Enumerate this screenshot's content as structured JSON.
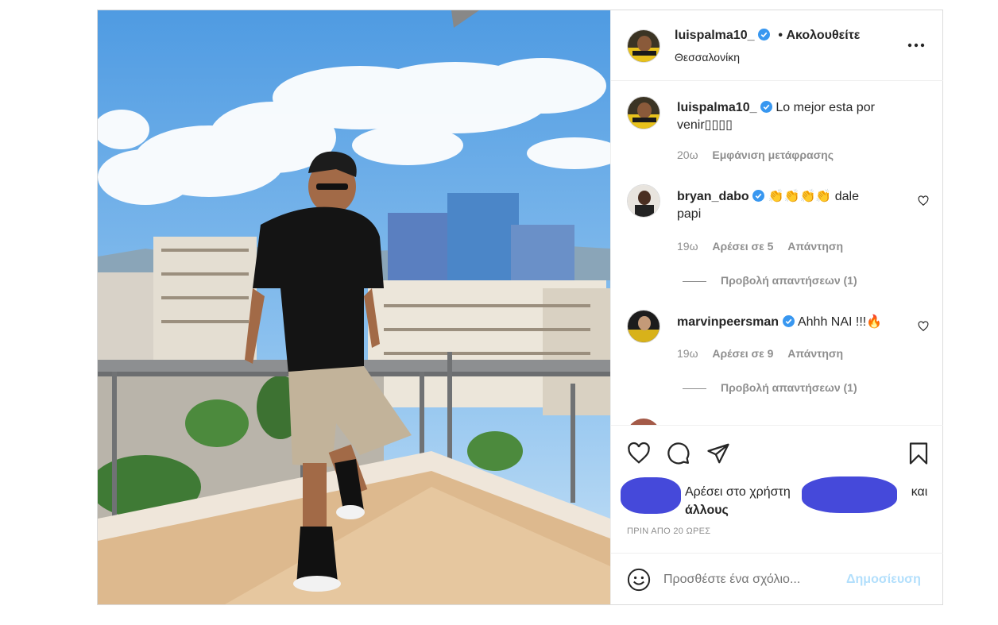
{
  "post": {
    "author": {
      "username": "luispalma10_",
      "follow_label": "• Ακολουθείτε",
      "location": "Θεσσαλονίκη"
    },
    "caption": {
      "username": "luispalma10_",
      "text_line1": "Lo mejor esta por",
      "text_line2": "venir▯▯▯▯",
      "time": "20ω",
      "translate_label": "Εμφάνιση μετάφρασης"
    },
    "comments": [
      {
        "username": "bryan_dabo",
        "text_line1": "👏👏👏👏 dale",
        "text_line2": "papi",
        "time": "19ω",
        "likes": "Αρέσει σε 5",
        "reply_label": "Απάντηση",
        "view_replies": "Προβολή απαντήσεων (1)"
      },
      {
        "username": "marvinpeersman",
        "text": "Ahhh NAI !!!🔥",
        "time": "19ω",
        "likes": "Αρέσει σε 9",
        "reply_label": "Απάντηση",
        "view_replies": "Προβολή απαντήσεων (1)"
      }
    ],
    "likes": {
      "prefix": "Αρέσει στο χρήστη",
      "suffix": "και",
      "others": "άλλους"
    },
    "timestamp": "ΠΡΙΝ ΑΠΟ 20 ΩΡΕΣ",
    "comment_input": {
      "placeholder": "Προσθέστε ένα σχόλιο...",
      "post_label": "Δημοσίευση"
    },
    "icons": {
      "more": "more-options-icon",
      "like": "heart-icon",
      "comment": "comment-icon",
      "share": "paper-plane-icon",
      "save": "bookmark-icon",
      "emoji": "emoji-icon",
      "verified": "verified-badge-icon"
    },
    "colors": {
      "verified": "#3897f0",
      "post_button_disabled": "#b2dffc",
      "meta": "#8e8e8e"
    }
  }
}
